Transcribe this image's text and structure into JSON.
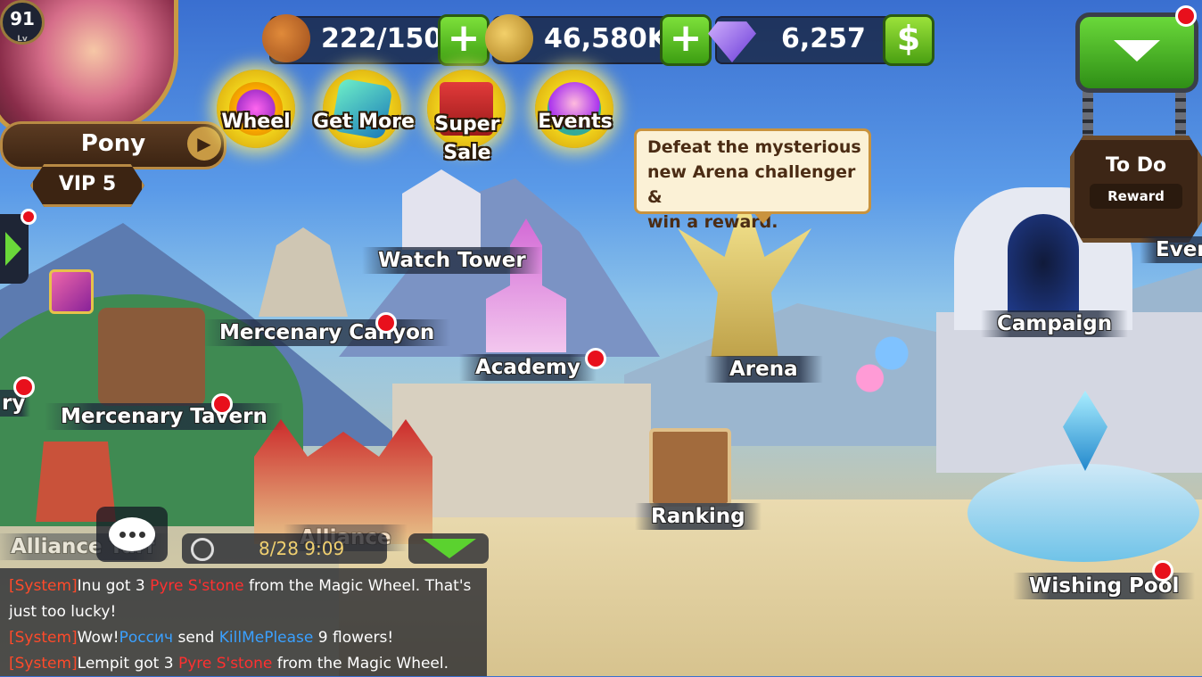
{
  "resources": {
    "stamina": {
      "value": "222/150",
      "icon": "meat-icon"
    },
    "gold": {
      "value": "46,580K",
      "icon": "gold-coin-icon"
    },
    "gems": {
      "value": "6,257",
      "icon": "diamond-icon"
    }
  },
  "player": {
    "level": "91",
    "level_sub": "Lv",
    "name": "Pony",
    "vip": "VIP 5"
  },
  "quick_buttons": [
    {
      "label": "Wheel",
      "icon": "wheel-icon"
    },
    {
      "label": "Get More",
      "icon": "gem-icon"
    },
    {
      "label": "Super Sale",
      "label_line1": "Super",
      "label_line2": "Sale",
      "icon": "gift-icon"
    },
    {
      "label": "Events",
      "icon": "event-egg-icon"
    }
  ],
  "tooltip": {
    "line1": "Defeat the mysterious",
    "line2": "new Arena challenger &",
    "line3": "win a reward."
  },
  "top_right": {
    "todo_title": "To Do",
    "todo_sub": "Reward",
    "events_label": "Event"
  },
  "buildings": {
    "watch_tower": "Watch Tower",
    "mercenary_canyon": "Mercenary Canyon",
    "academy": "Academy",
    "arena": "Arena",
    "campaign": "Campaign",
    "mercenary_tavern": "Mercenary Tavern",
    "left_partial": "ry",
    "ranking": "Ranking",
    "alliance": "Alliance",
    "alliance_turf": "Alliance Turf",
    "wishing_pool": "Wishing Pool"
  },
  "chat": {
    "time": "8/28 9:09",
    "messages": [
      {
        "tag": "[System]",
        "parts": [
          {
            "t": "Inu got 3 ",
            "c": "plain"
          },
          {
            "t": "Pyre S'stone",
            "c": "red"
          },
          {
            "t": " from the Magic Wheel. That's just too lucky!",
            "c": "plain"
          }
        ]
      },
      {
        "tag": "[System]",
        "parts": [
          {
            "t": "Wow!",
            "c": "plain"
          },
          {
            "t": "Россич",
            "c": "blue"
          },
          {
            "t": " send ",
            "c": "plain"
          },
          {
            "t": "KillMePlease",
            "c": "blue"
          },
          {
            "t": " 9 flowers!",
            "c": "plain"
          }
        ]
      },
      {
        "tag": "[System]",
        "parts": [
          {
            "t": "Lempit got 3 ",
            "c": "plain"
          },
          {
            "t": "Pyre S'stone",
            "c": "red"
          },
          {
            "t": " from the Magic Wheel.",
            "c": "plain"
          }
        ]
      }
    ]
  },
  "colors": {
    "accent_green": "#5bd22f",
    "notify_red": "#e8101c",
    "gold": "#f2d51c"
  }
}
